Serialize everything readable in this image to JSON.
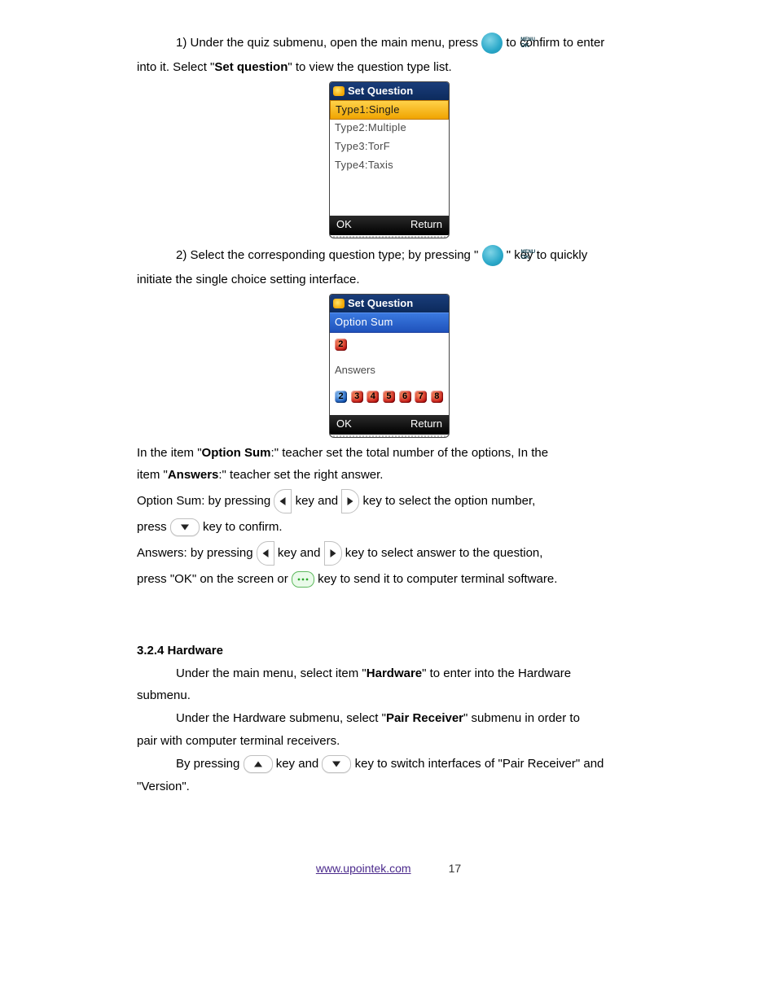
{
  "icons": {
    "menu_line1": "MENU",
    "menu_line2": "OK"
  },
  "para1": {
    "t1": "1) Under the quiz submenu, open the main menu, press ",
    "t2": " to confirm to enter",
    "t3": "into it. Select \"",
    "bold": "Set question",
    "t4": "\" to view the question type list."
  },
  "screen1": {
    "title": "Set Question",
    "items": [
      "Type1:Single",
      "Type2:Multiple",
      "Type3:TorF",
      "Type4:Taxis"
    ],
    "ok": "OK",
    "ret": "Return"
  },
  "para2": {
    "t1": "2) Select the corresponding question type; by pressing \"",
    "t2": "\" key to quickly",
    "t3": "initiate the single choice setting interface."
  },
  "screen2": {
    "title": "Set Question",
    "header": "Option  Sum",
    "first": "2",
    "answers_label": "Answers",
    "answers": [
      "2",
      "3",
      "4",
      "5",
      "6",
      "7",
      "8"
    ],
    "ok": "OK",
    "ret": "Return"
  },
  "para3": {
    "line1_a": "In the item \"",
    "line1_b": "Option Sum",
    "line1_c": ":\" teacher set the total number of the options, In the",
    "line2_a": "item \"",
    "line2_b": "Answers",
    "line2_c": ":\" teacher set the right answer.",
    "opsum_a": "Option Sum: by pressing ",
    "opsum_b": " key and ",
    "opsum_c": " key to select the option number,",
    "opsum_d": "press ",
    "opsum_e": " key to confirm.",
    "ans_a": "Answers: by pressing ",
    "ans_b": " key and ",
    "ans_c": " key to select answer to the question,",
    "ans_d": "press \"OK\" on the screen or ",
    "ans_e": " key to send it to computer terminal software."
  },
  "section": {
    "num": "3.2.4",
    "title": " Hardware",
    "p1_a": "Under the main menu, select item \"",
    "p1_b": "Hardware",
    "p1_c": "\" to enter into the Hardware",
    "p1_d": "submenu.",
    "p2_a": "Under the Hardware submenu, select \"",
    "p2_b": "Pair Receiver",
    "p2_c": "\" submenu in order to",
    "p2_d": "pair with computer terminal receivers.",
    "p3_a": "By pressing ",
    "p3_b": " key and ",
    "p3_c": " key to switch interfaces of \"Pair Receiver\" and",
    "p3_d": "\"Version\"."
  },
  "footer": {
    "site": "www.upointek.com",
    "page": "17"
  }
}
